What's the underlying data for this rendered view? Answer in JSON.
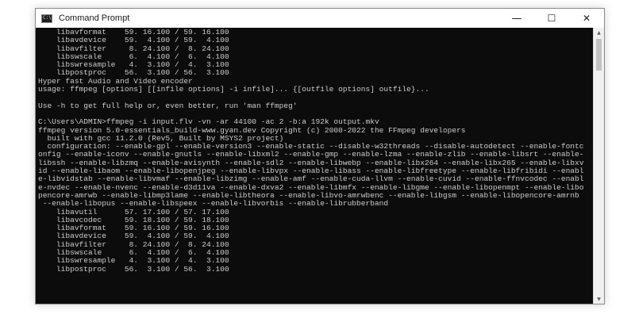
{
  "window": {
    "title": "Command Prompt",
    "app_icon_text": "C:\\"
  },
  "controls": {
    "minimize": "—",
    "maximize": "☐",
    "close": "✕"
  },
  "console": {
    "lines": [
      "    libavformat    59. 16.100 / 59. 16.100",
      "    libavdevice    59.  4.100 / 59.  4.100",
      "    libavfilter     8. 24.100 /  8. 24.100",
      "    libswscale      6.  4.100 /  6.  4.100",
      "    libswresample   4.  3.100 /  4.  3.100",
      "    libpostproc    56.  3.100 / 56.  3.100",
      "Hyper fast Audio and Video encoder",
      "usage: ffmpeg [options] [[infile options] -i infile]... {[outfile options] outfile}...",
      "",
      "Use -h to get full help or, even better, run 'man ffmpeg'",
      "",
      "C:\\Users\\ADMIN>ffmpeg -i input.flv -vn -ar 44100 -ac 2 -b:a 192k output.mkv",
      "ffmpeg version 5.0-essentials_build-www.gyan.dev Copyright (c) 2000-2022 the FFmpeg developers",
      "  built with gcc 11.2.0 (Rev5, Built by MSYS2 project)",
      "  configuration: --enable-gpl --enable-version3 --enable-static --disable-w32threads --disable-autodetect --enable-fontc",
      "onfig --enable-iconv --enable-gnutls --enable-libxml2 --enable-gmp --enable-lzma --enable-zlib --enable-libsrt --enable-",
      "libssh --enable-libzmq --enable-avisynth --enable-sdl2 --enable-libwebp --enable-libx264 --enable-libx265 --enable-libxv",
      "id --enable-libaom --enable-libopenjpeg --enable-libvpx --enable-libass --enable-libfreetype --enable-libfribidi --enabl",
      "e-libvidstab --enable-libvmaf --enable-libzimg --enable-amf --enable-cuda-llvm --enable-cuvid --enable-ffnvcodec --enabl",
      "e-nvdec --enable-nvenc --enable-d3d11va --enable-dxva2 --enable-libmfx --enable-libgme --enable-libopenmpt --enable-libo",
      "pencore-amrwb --enable-libmp3lame --enable-libtheora --enable-libvo-amrwbenc --enable-libgsm --enable-libopencore-amrnb",
      " --enable-libopus --enable-libspeex --enable-libvorbis --enable-librubberband",
      "    libavutil      57. 17.100 / 57. 17.100",
      "    libavcodec     59. 18.100 / 59. 18.100",
      "    libavformat    59. 16.100 / 59. 16.100",
      "    libavdevice    59.  4.100 / 59.  4.100",
      "    libavfilter     8. 24.100 /  8. 24.100",
      "    libswscale      6.  4.100 /  6.  4.100",
      "    libswresample   4.  3.100 /  4.  3.100",
      "    libpostproc    56.  3.100 / 56.  3.100"
    ]
  },
  "scrollbar": {
    "up_arrow": "▲",
    "down_arrow": "▼",
    "thumb": ""
  }
}
